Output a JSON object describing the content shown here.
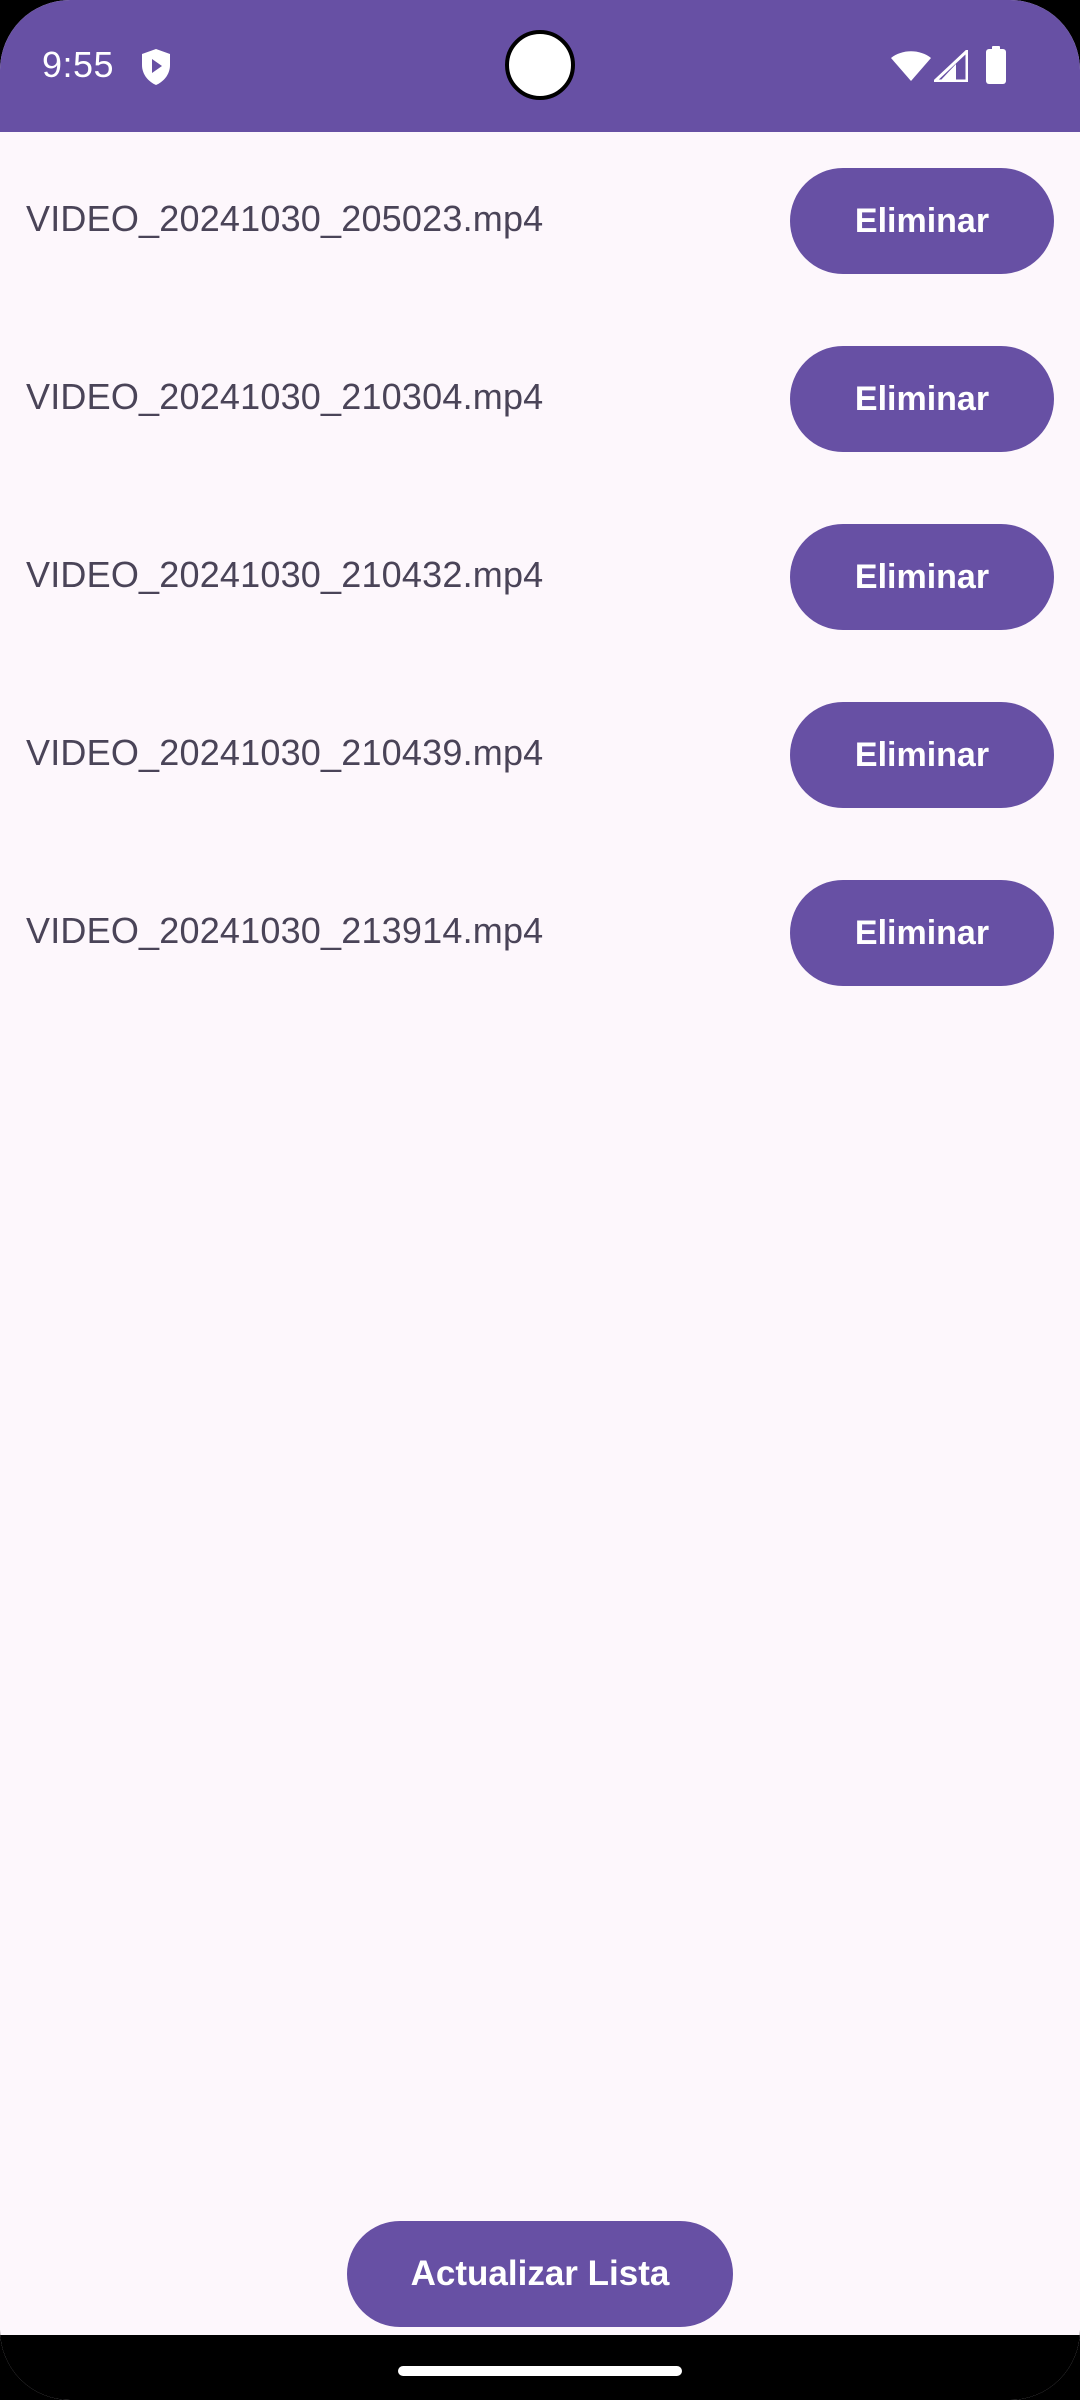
{
  "status_bar": {
    "time": "9:55",
    "background_color": "#6750A4",
    "icons": [
      "shield-icon",
      "wifi-icon",
      "signal-icon",
      "battery-icon"
    ]
  },
  "videos": [
    {
      "name": "VIDEO_20241030_205023.mp4",
      "action_label": "Eliminar"
    },
    {
      "name": "VIDEO_20241030_210304.mp4",
      "action_label": "Eliminar"
    },
    {
      "name": "VIDEO_20241030_210432.mp4",
      "action_label": "Eliminar"
    },
    {
      "name": "VIDEO_20241030_210439.mp4",
      "action_label": "Eliminar"
    },
    {
      "name": "VIDEO_20241030_213914.mp4",
      "action_label": "Eliminar"
    }
  ],
  "footer": {
    "refresh_label": "Actualizar Lista"
  },
  "colors": {
    "accent": "#6750A4",
    "background": "#FDF7FC",
    "text": "#4A4458"
  }
}
